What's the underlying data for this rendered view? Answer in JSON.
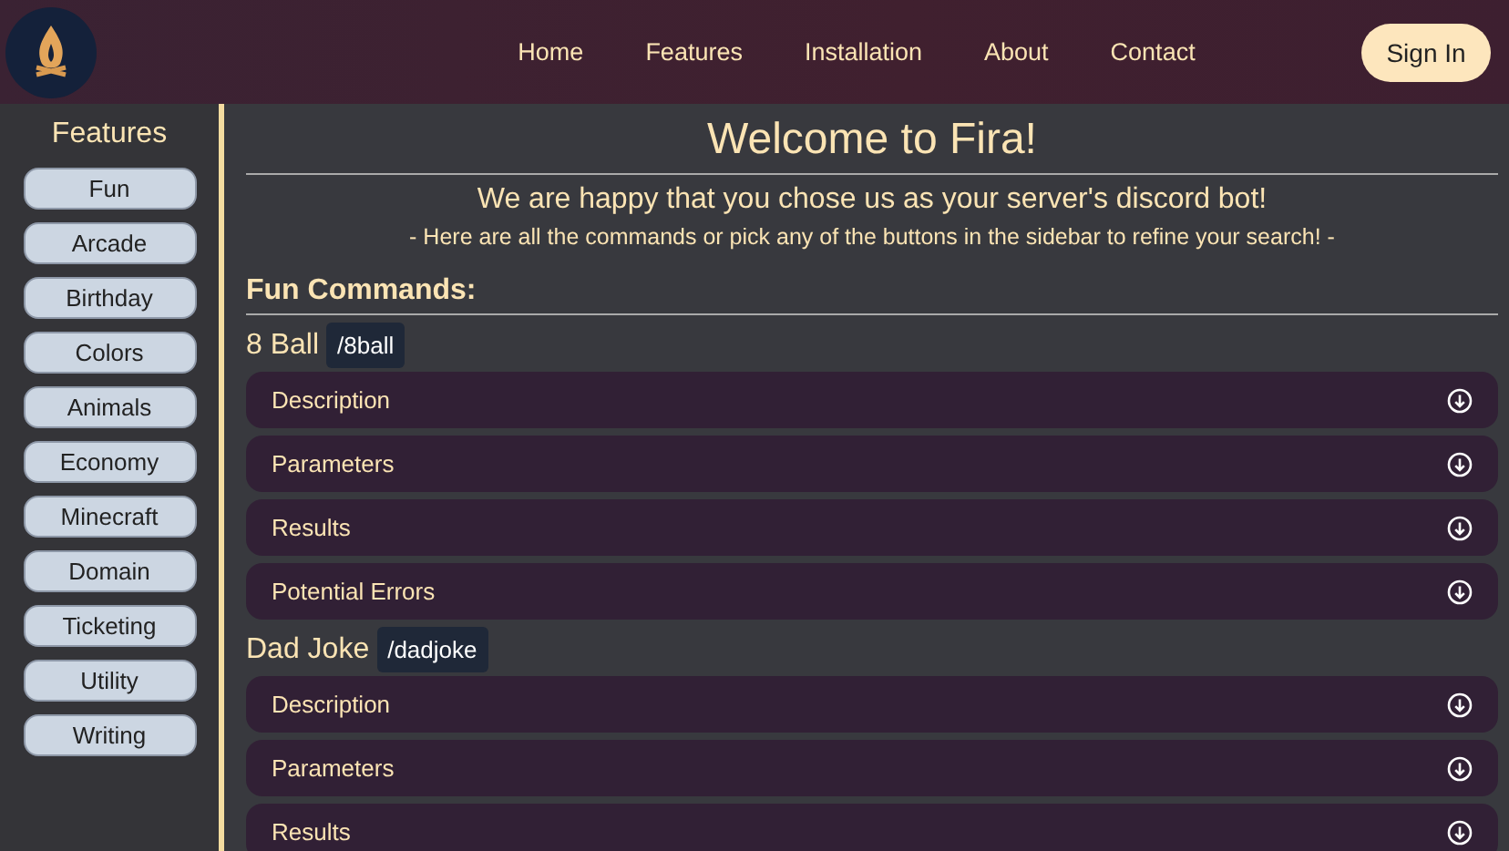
{
  "nav": {
    "links": [
      "Home",
      "Features",
      "Installation",
      "About",
      "Contact"
    ],
    "sign_in": "Sign In"
  },
  "sidebar": {
    "title": "Features",
    "items": [
      "Fun",
      "Arcade",
      "Birthday",
      "Colors",
      "Animals",
      "Economy",
      "Minecraft",
      "Domain",
      "Ticketing",
      "Utility",
      "Writing"
    ]
  },
  "main": {
    "title": "Welcome to Fira!",
    "subtitle": "We are happy that you chose us as your server's discord bot!",
    "hint": "- Here are all the commands or pick any of the buttons in the sidebar to refine your search! -",
    "section_title": "Fun Commands:",
    "commands": [
      {
        "name": "8 Ball",
        "command": "/8ball",
        "sections": [
          "Description",
          "Parameters",
          "Results",
          "Potential Errors"
        ]
      },
      {
        "name": "Dad Joke",
        "command": "/dadjoke",
        "sections": [
          "Description",
          "Parameters",
          "Results"
        ]
      }
    ]
  }
}
